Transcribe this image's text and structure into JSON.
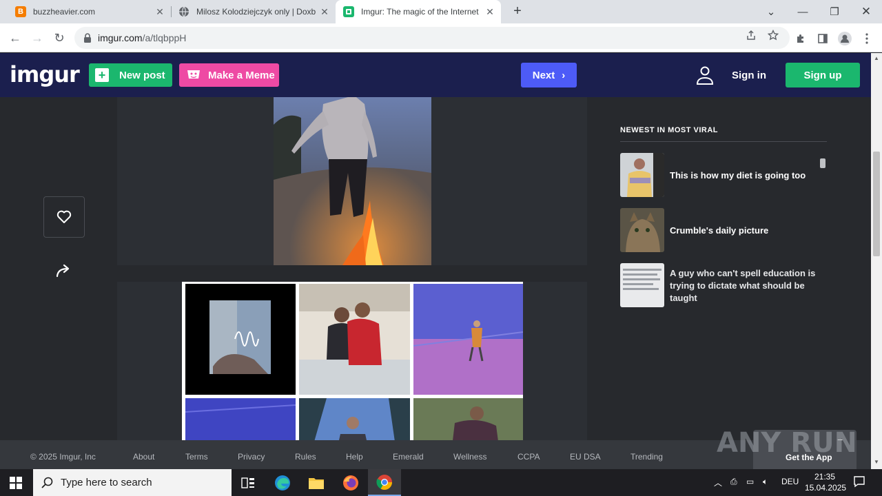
{
  "browser": {
    "tabs": [
      {
        "title": "buzzheavier.com",
        "favicon": "blogger-icon"
      },
      {
        "title": "Milosz Kolodziejczyk only | Doxb",
        "favicon": "globe-icon"
      },
      {
        "title": "Imgur: The magic of the Internet",
        "favicon": "imgur-icon",
        "active": true
      }
    ],
    "url_host": "imgur.com",
    "url_path": "/a/tlqbppH"
  },
  "header": {
    "logo": "imgur",
    "new_post": "New post",
    "make_meme": "Make a Meme",
    "next": "Next",
    "sign_in": "Sign in",
    "sign_up": "Sign up"
  },
  "sidebar": {
    "heading": "NEWEST IN MOST VIRAL",
    "items": [
      {
        "title": "This is how my diet is going too"
      },
      {
        "title": "Crumble's daily picture"
      },
      {
        "title": "A guy who can't spell education is trying to dictate what should be taught"
      }
    ]
  },
  "footer": {
    "copyright": "© 2025 Imgur, Inc",
    "links": [
      "About",
      "Terms",
      "Privacy",
      "Rules",
      "Help",
      "Emerald",
      "Wellness",
      "CCPA",
      "EU DSA",
      "Trending"
    ],
    "get_app": "Get the App"
  },
  "watermark": "ANY RUN",
  "taskbar": {
    "search_placeholder": "Type here to search",
    "lang": "DEU",
    "time": "21:35",
    "date": "15.04.2025"
  },
  "colors": {
    "imgur_header": "#1b1f4e",
    "new_post_green": "#1bb76e",
    "meme_pink": "#ee4aa4",
    "next_blue": "#4d5bf7",
    "page_bg": "#27292d"
  }
}
